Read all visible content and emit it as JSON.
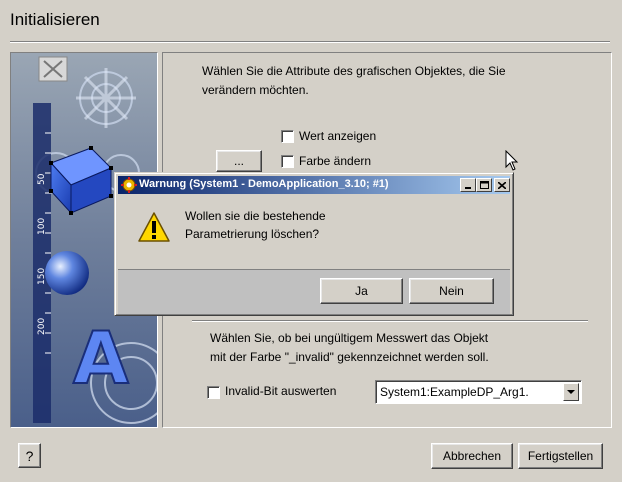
{
  "wizard": {
    "title": "Initialisieren",
    "instruction_line1": "Wählen Sie die Attribute des grafischen Objektes, die Sie",
    "instruction_line2": "verändern möchten.",
    "attributes": [
      {
        "label": "Wert anzeigen",
        "checked": false
      },
      {
        "label": "Farbe ändern",
        "checked": false
      }
    ],
    "ellipsis_label": "...",
    "invalid_text_line1": "Wählen Sie, ob bei ungültigem Messwert das Objekt",
    "invalid_text_line2": "mit der Farbe \"_invalid\" gekennzeichnet werden soll.",
    "invalid_checkbox_label": "Invalid-Bit auswerten",
    "dp_select_value": "System1:ExampleDP_Arg1.",
    "help_label": "?",
    "cancel_label": "Abbrechen",
    "finish_label": "Fertigstellen"
  },
  "dialog": {
    "title": "Warnung (System1 - DemoApplication_3.10; #1)",
    "message_line1": "Wollen sie die bestehende",
    "message_line2": "Parametrierung löschen?",
    "yes_label": "Ja",
    "no_label": "Nein",
    "icon": "warning-icon"
  },
  "side_image": {
    "ruler_labels": [
      "50",
      "100",
      "150",
      "200"
    ]
  },
  "colors": {
    "title_gradient_start": "#0a246a",
    "title_gradient_end": "#a6caf0",
    "window_bg": "#d4d0c8"
  }
}
